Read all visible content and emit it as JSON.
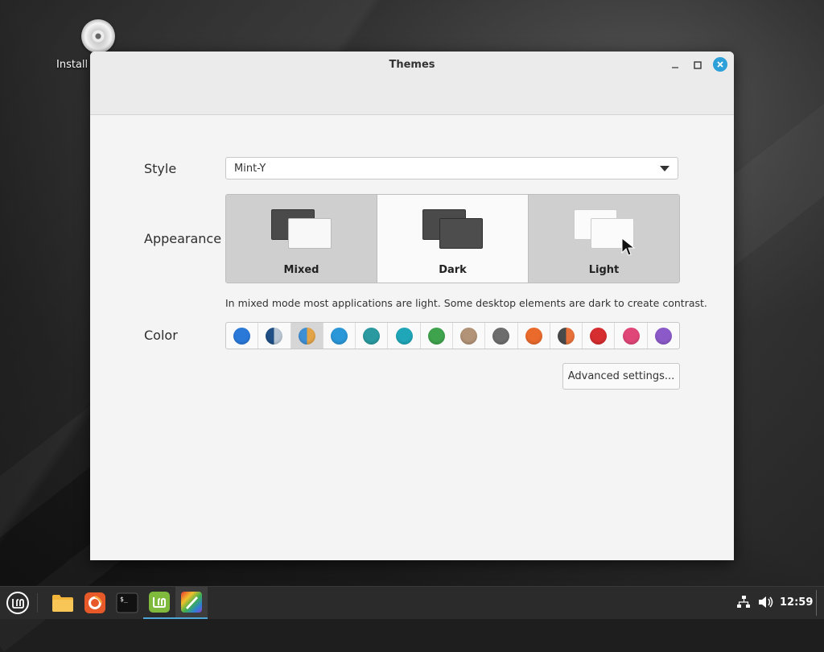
{
  "desktop": {
    "icon_label": "Install"
  },
  "window": {
    "title": "Themes",
    "style_label": "Style",
    "style_value": "Mint-Y",
    "appearance_label": "Appearance",
    "appearance_options": [
      {
        "label": "Mixed",
        "selected": false
      },
      {
        "label": "Dark",
        "selected": true
      },
      {
        "label": "Light",
        "selected": false
      }
    ],
    "description": "In mixed mode most applications are light. Some desktop elements are dark to create contrast.",
    "color_label": "Color",
    "colors": [
      "#2a78d8",
      "#1f4f85/#b9c6d3",
      "#3f8fd4/#e3a448",
      "#2a97d8",
      "#2a9aa0",
      "#1fa6b8",
      "#3fa34d",
      "#b29377",
      "#6d6d6d",
      "#ea6a2c",
      "#4a4a4a/#e8713a",
      "#d62d30",
      "#e04677",
      "#8b5ac8"
    ],
    "selected_color_index": 2,
    "advanced_button": "Advanced settings..."
  },
  "taskbar": {
    "apps": [
      "menu",
      "files",
      "firefox",
      "terminal",
      "mintinstall",
      "themes"
    ],
    "clock": "12:59"
  }
}
